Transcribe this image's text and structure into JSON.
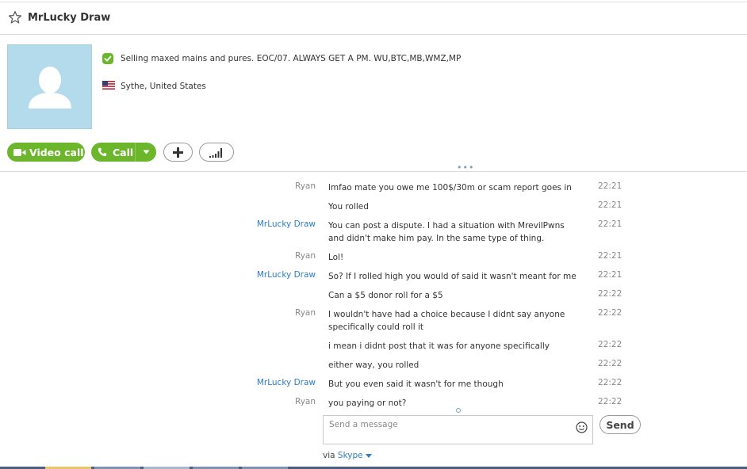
{
  "contact": {
    "name": "MrLucky Draw",
    "mood": "Selling maxed mains and pures. EOC/07. ALWAYS GET A PM.  WU,BTC,MB,WMZ,MP",
    "location": "Sythe, United States"
  },
  "actions": {
    "video_call": "Video call",
    "call": "Call"
  },
  "messages": [
    {
      "sender": "Ryan",
      "text": "lmfao mate you owe me 100$/30m or scam report goes in",
      "time": "22:21",
      "self": false
    },
    {
      "sender": "",
      "text": "You rolled",
      "time": "22:21",
      "self": false
    },
    {
      "sender": "MrLucky Draw",
      "text": "You can post a dispute.  I had a situation with MrevilPwns and didn't make him pay. In the same type of thing.",
      "time": "22:21",
      "self": true
    },
    {
      "sender": "Ryan",
      "text": "Lol!",
      "time": "22:21",
      "self": false
    },
    {
      "sender": "MrLucky Draw",
      "text": "So? If I rolled high you would of said it wasn't meant for me",
      "time": "22:21",
      "self": true
    },
    {
      "sender": "",
      "text": "Can a $5 donor roll for a $5",
      "time": "22:22",
      "self": true
    },
    {
      "sender": "Ryan",
      "text": "I wouldn't have had a choice because I didnt say anyone specifically could roll it",
      "time": "22:22",
      "self": false
    },
    {
      "sender": "",
      "text": "i mean i didnt post that it was for anyone specifically",
      "time": "22:22",
      "self": false
    },
    {
      "sender": "",
      "text": "either way, you rolled",
      "time": "22:22",
      "self": false
    },
    {
      "sender": "MrLucky Draw",
      "text": "But you even said it wasn't for me though",
      "time": "22:22",
      "self": true
    },
    {
      "sender": "Ryan",
      "text": "you paying or not?",
      "time": "22:22",
      "self": false
    }
  ],
  "composer": {
    "placeholder": "Send a message",
    "send_label": "Send",
    "via_label": "via",
    "via_service": "Skype"
  },
  "colors": {
    "accent_green": "#6cb62b",
    "link_blue": "#2d7dc6",
    "avatar_bg": "#b4dbec"
  }
}
